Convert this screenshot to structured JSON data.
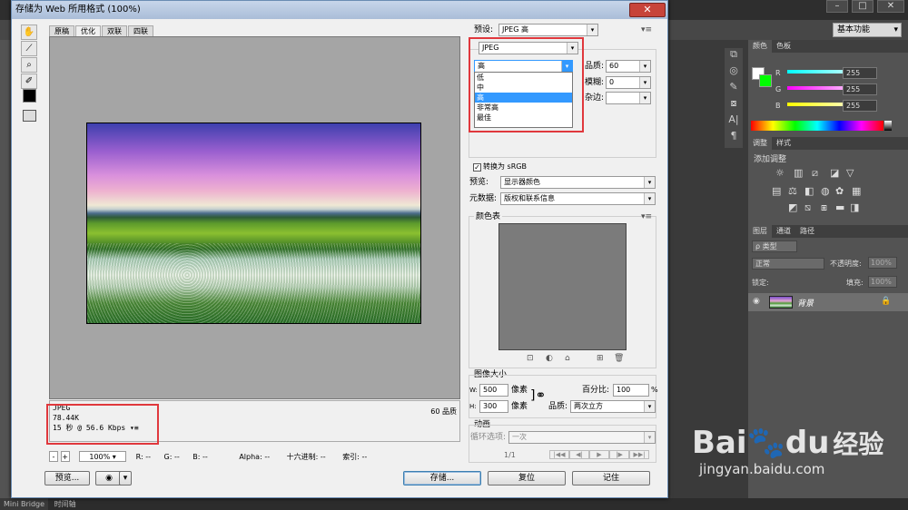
{
  "dialog": {
    "title": "存储为 Web 所用格式 (100%)",
    "tabs": [
      "原稿",
      "优化",
      "双联",
      "四联"
    ],
    "active_tab": "优化",
    "info_lines": [
      "JPEG",
      "78.44K",
      "15 秒 @ 56.6 Kbps"
    ],
    "info_menu_icon": "▾≡",
    "quality_label": "60 品质",
    "status": {
      "zoom": "100%",
      "r": "R: --",
      "g": "G: --",
      "b": "B: --",
      "alpha": "Alpha: --",
      "hex": "十六进制: --",
      "index": "索引: --"
    },
    "buttons": {
      "preview": "预览...",
      "save": "存储...",
      "reset": "复位",
      "remember": "记住"
    }
  },
  "settings": {
    "preset_label": "预设:",
    "preset_value": "JPEG 高",
    "format_value": "JPEG",
    "quality_select_value": "高",
    "quality_options": [
      "低",
      "中",
      "高",
      "非常高",
      "最佳"
    ],
    "quality_options_selected": "高",
    "quality_label": "品质:",
    "quality_value": "60",
    "blur_label": "模糊:",
    "blur_value": "0",
    "matte_label": "杂边:",
    "convert_srgb": "转换为 sRGB",
    "preview_label": "预览:",
    "preview_value": "显示器颜色",
    "metadata_label": "元数据:",
    "metadata_value": "版权和联系信息",
    "color_table_title": "颜色表",
    "image_size_title": "图像大小",
    "w_label": "W:",
    "w_value": "500",
    "h_label": "H:",
    "h_value": "300",
    "px_unit": "像素",
    "percent_label": "百分比:",
    "percent_value": "100",
    "percent_unit": "%",
    "quality2_label": "品质:",
    "quality2_value": "两次立方",
    "animation_title": "动画",
    "loop_label": "循环选项:",
    "loop_value": "一次",
    "frame_counter": "1/1"
  },
  "ps": {
    "workspace": "基本功能",
    "color_panel": {
      "tabs": [
        "颜色",
        "色板"
      ],
      "r_label": "R",
      "g_label": "G",
      "b_label": "B",
      "r": "255",
      "g": "255",
      "b": "255"
    },
    "adjust_panel": {
      "tabs": [
        "调整",
        "样式"
      ],
      "title": "添加调整"
    },
    "layers_panel": {
      "tabs": [
        "图层",
        "通道",
        "路径"
      ],
      "kind": "ρ 类型",
      "blend_mode": "正常",
      "opacity_label": "不透明度:",
      "opacity": "100%",
      "lock_label": "锁定:",
      "fill_label": "填充:",
      "fill": "100%",
      "layer_name": "背景"
    },
    "bottom_tabs": [
      "Mini Bridge",
      "时间轴"
    ]
  },
  "watermark": {
    "brand": "Bai",
    "brand2": "du",
    "cn": "经验",
    "url": "jingyan.baidu.com"
  }
}
